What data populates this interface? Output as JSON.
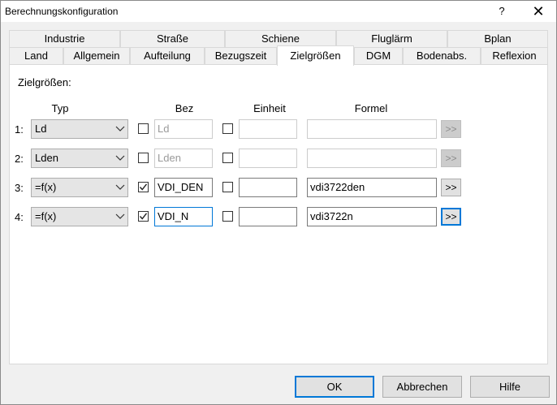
{
  "window": {
    "title": "Berechnungskonfiguration",
    "help": "?",
    "close": "✕"
  },
  "tabs_row1": [
    "Industrie",
    "Straße",
    "Schiene",
    "Fluglärm",
    "Bplan"
  ],
  "tabs_row2": [
    "Land",
    "Allgemein",
    "Aufteilung",
    "Bezugszeit",
    "Zielgrößen",
    "DGM",
    "Bodenabs.",
    "Reflexion"
  ],
  "active_tab": "Zielgrößen",
  "panel": {
    "caption": "Zielgrößen:",
    "headers": {
      "typ": "Typ",
      "bez": "Bez",
      "einheit": "Einheit",
      "formel": "Formel"
    },
    "rows": [
      {
        "index": "1:",
        "typ": "Ld",
        "bez_checked": false,
        "bez": "Ld",
        "einheit_checked": false,
        "einheit": "",
        "formel": "",
        "formel_button": ">>",
        "enabled": false
      },
      {
        "index": "2:",
        "typ": "Lden",
        "bez_checked": false,
        "bez": "Lden",
        "einheit_checked": false,
        "einheit": "",
        "formel": "",
        "formel_button": ">>",
        "enabled": false
      },
      {
        "index": "3:",
        "typ": "=f(x)",
        "bez_checked": true,
        "bez": "VDI_DEN",
        "einheit_checked": false,
        "einheit": "",
        "formel": "vdi3722den",
        "formel_button": ">>",
        "enabled": true
      },
      {
        "index": "4:",
        "typ": "=f(x)",
        "bez_checked": true,
        "bez": "VDI_N",
        "einheit_checked": false,
        "einheit": "",
        "formel": "vdi3722n",
        "formel_button": ">>",
        "enabled": true
      }
    ]
  },
  "buttons": {
    "ok": "OK",
    "cancel": "Abbrechen",
    "help": "Hilfe"
  },
  "colors": {
    "accent": "#0078d7",
    "disabled_text": "#9a9a9a",
    "dialog_bg": "#f0f0f0"
  }
}
